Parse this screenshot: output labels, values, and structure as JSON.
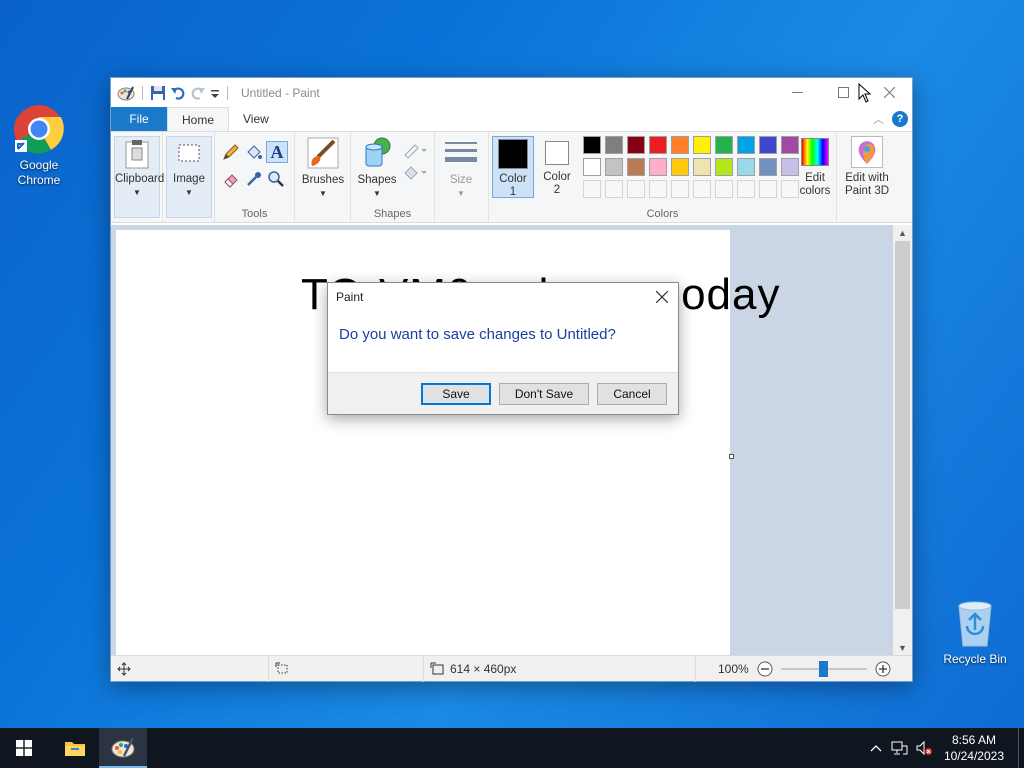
{
  "desktop": {
    "icons": [
      {
        "label_line1": "Google",
        "label_line2": "Chrome",
        "icon": "chrome-icon"
      },
      {
        "label": "Recycle Bin",
        "icon": "recycle-bin-icon"
      }
    ]
  },
  "window": {
    "title": "Untitled - Paint",
    "tabs": {
      "file": "File",
      "home": "Home",
      "view": "View"
    },
    "ribbon": {
      "clipboard": "Clipboard",
      "image": "Image",
      "tools_group": "Tools",
      "brushes": "Brushes",
      "shapes": "Shapes",
      "shapes_group": "Shapes",
      "size": "Size",
      "color1_line1": "Color",
      "color1_line2": "1",
      "color2_line1": "Color",
      "color2_line2": "2",
      "colors_group": "Colors",
      "edit_colors_line1": "Edit",
      "edit_colors_line2": "colors",
      "paint3d_line1": "Edit with",
      "paint3d_line2": "Paint 3D",
      "palette_row1": [
        "#000000",
        "#7f7f7f",
        "#880015",
        "#ed1c24",
        "#ff7f27",
        "#fff200",
        "#22b14c",
        "#00a2e8",
        "#3f48cc",
        "#a349a4"
      ],
      "palette_row2": [
        "#ffffff",
        "#c3c3c3",
        "#b97a57",
        "#ffaec9",
        "#ffc90e",
        "#efe4b0",
        "#b5e61d",
        "#99d9ea",
        "#7092be",
        "#c8bfe7"
      ],
      "color1": "#000000",
      "color2": "#ffffff"
    },
    "canvas_text": "TO-VM0 ... hoo ... oday",
    "status": {
      "dimensions": "614 × 460px",
      "zoom": "100%"
    }
  },
  "dialog": {
    "title": "Paint",
    "message": "Do you want to save changes to Untitled?",
    "save": "Save",
    "dont_save": "Don't Save",
    "cancel": "Cancel"
  },
  "taskbar": {
    "time": "8:56 AM",
    "date": "10/24/2023"
  }
}
